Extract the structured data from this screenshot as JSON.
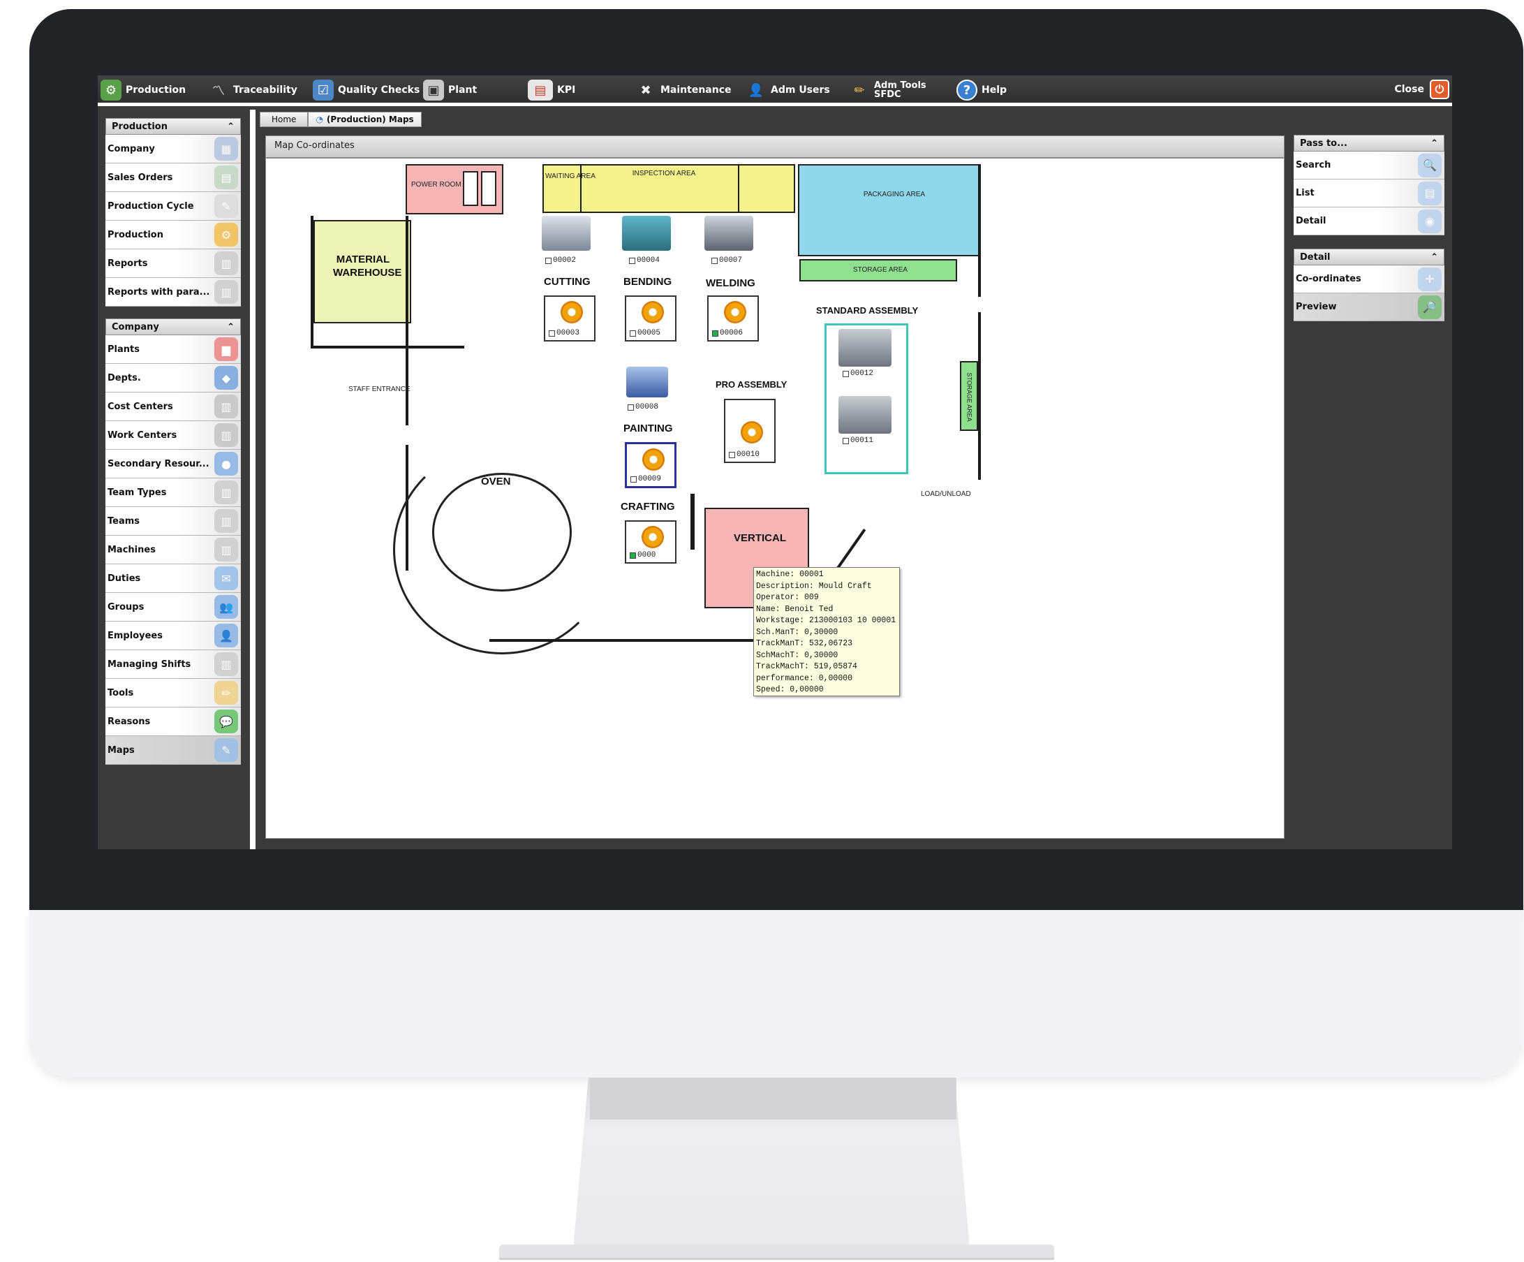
{
  "menubar": {
    "items": [
      {
        "label": "Production"
      },
      {
        "label": "Traceability"
      },
      {
        "label": "Quality Checks"
      },
      {
        "label": "Plant"
      },
      {
        "label": "KPI"
      },
      {
        "label": "Maintenance"
      },
      {
        "label": "Adm Users"
      },
      {
        "label": "Adm Tools",
        "sub": "SFDC"
      },
      {
        "label": "Help"
      }
    ],
    "close_label": "Close"
  },
  "left_panel": {
    "groups": [
      {
        "title": "Production",
        "items": [
          "Company",
          "Sales Orders",
          "Production Cycle",
          "Production",
          "Reports",
          "Reports with para..."
        ]
      },
      {
        "title": "Company",
        "items": [
          "Plants",
          "Depts.",
          "Cost Centers",
          "Work Centers",
          "Secondary Resour...",
          "Team Types",
          "Teams",
          "Machines",
          "Duties",
          "Groups",
          "Employees",
          "Managing Shifts",
          "Tools",
          "Reasons",
          "Maps"
        ]
      }
    ],
    "active_item": "Maps"
  },
  "right_panel": {
    "groups": [
      {
        "title": "Pass to...",
        "items": [
          "Search",
          "List",
          "Detail"
        ]
      },
      {
        "title": "Detail",
        "items": [
          "Co-ordinates",
          "Preview"
        ]
      }
    ]
  },
  "breadcrumb": {
    "home": "Home",
    "current": "(Production) Maps"
  },
  "map": {
    "header": "Map Co-ordinates",
    "labels": {
      "power_room": "POWER ROOM",
      "waiting_area": "WAITING AREA",
      "inspection_area": "INSPECTION AREA",
      "packaging_area": "PACKAGING AREA",
      "storage_area": "STORAGE AREA",
      "storage_area_vertical": "STORAGE AREA",
      "material_warehouse": "MATERIAL WAREHOUSE",
      "cutting": "CUTTING",
      "bending": "BENDING",
      "welding": "WELDING",
      "standard_assembly": "STANDARD ASSEMBLY",
      "staff_entrance": "STAFF ENTRANCE",
      "painting": "PAINTING",
      "pro_assembly": "PRO ASSEMBLY",
      "oven": "OVEN",
      "crafting": "CRAFTING",
      "vertical": "VERTICAL",
      "load_unload": "LOAD/UNLOAD"
    },
    "machines": {
      "m00002": "00002",
      "m00004": "00004",
      "m00007": "00007",
      "m00003": "00003",
      "m00005": "00005",
      "m00006": "00006",
      "m00008": "00008",
      "m00009": "00009",
      "m00010": "00010",
      "m00012": "00012",
      "m00011": "00011",
      "m00001": "0000"
    },
    "tooltip": [
      "Machine: 00001",
      "Description: Mould Craft",
      "Operator: 009",
      "Name: Benoit Ted",
      "Workstage: 213000103 10 00001",
      "Sch.ManT: 0,30000",
      "TrackManT: 532,06723",
      "SchMachT: 0,30000",
      "TrackMachT: 519,05874",
      "performance: 0,00000",
      "Speed: 0,00000"
    ]
  },
  "colors": {
    "accent_close": "#e25d2c",
    "status_green": "#21b14a",
    "status_red": "#d93a3a",
    "inspection_yellow": "#f4f28a",
    "packaging_blue": "#8fd8ec",
    "storage_green": "#8fe08f",
    "power_pink": "#f7b5b5",
    "vertical_pink": "#f7b5b5"
  }
}
